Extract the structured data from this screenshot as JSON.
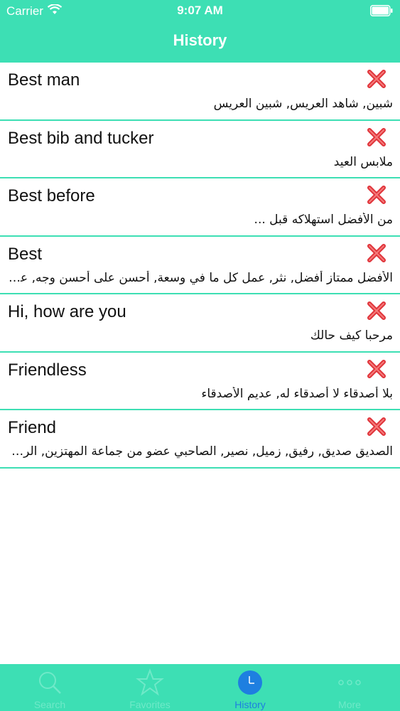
{
  "status": {
    "carrier": "Carrier",
    "time": "9:07 AM"
  },
  "header": {
    "title": "History"
  },
  "items": [
    {
      "term": "Best man",
      "translation": "شبين, شاهد العريس, شبين العريس"
    },
    {
      "term": "Best bib and tucker",
      "translation": "ملابس العيد"
    },
    {
      "term": "Best before",
      "translation": "من الأفضل استهلاكه قبل ..."
    },
    {
      "term": "Best",
      "translation": "الأفضل ممتاز أفضل, نثر, عمل كل ما في وسعة, أحسن على أحسن وجه, عمل كل ما في وسعه"
    },
    {
      "term": "Hi, how are you",
      "translation": "مرحبا كيف حالك"
    },
    {
      "term": "Friendless",
      "translation": "بلا أصدقاء لا أصدقاء له, عديم الأصدقاء"
    },
    {
      "term": "Friend",
      "translation": "الصديق صديق, رفيق, زميل, نصير, الصاحبي عضو من جماعة المهتزين, الرفيق"
    }
  ],
  "tabs": [
    {
      "label": "Search",
      "icon": "search-icon"
    },
    {
      "label": "Favorites",
      "icon": "star-icon"
    },
    {
      "label": "History",
      "icon": "clock-icon",
      "active": true
    },
    {
      "label": "More",
      "icon": "more-icon"
    }
  ],
  "colors": {
    "accent": "#3ddfb4",
    "active_tab": "#1e7fe0",
    "delete": "#e0333a"
  }
}
